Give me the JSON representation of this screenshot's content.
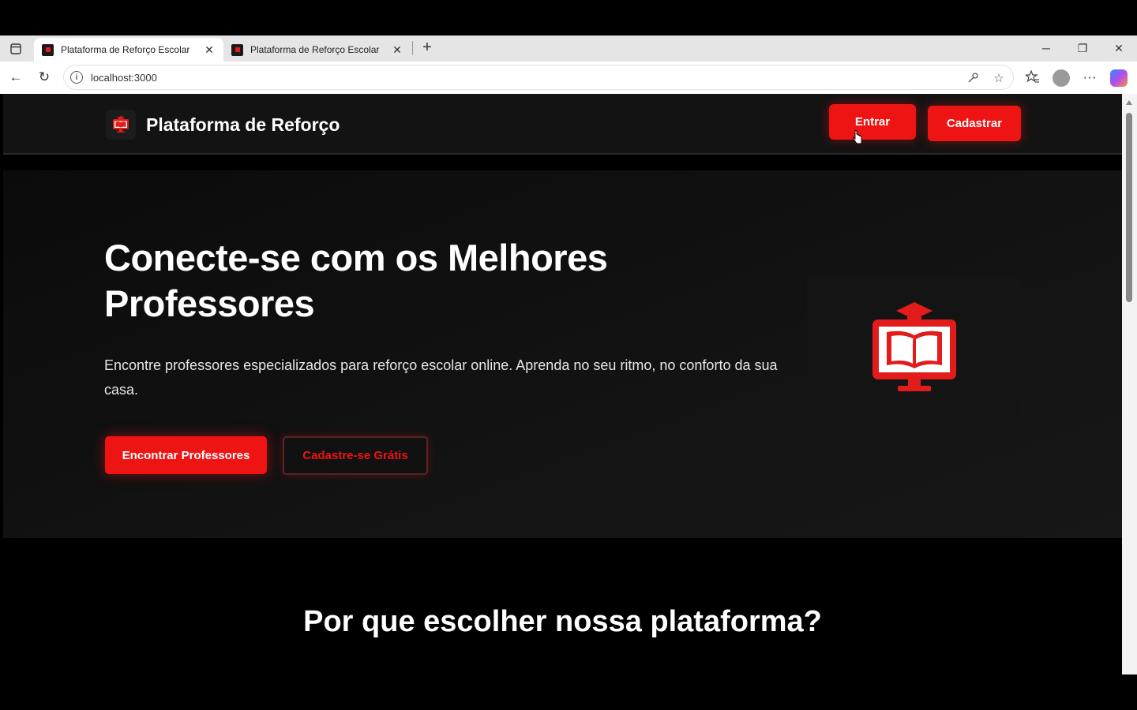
{
  "browser": {
    "tabs": [
      {
        "title": "Plataforma de Reforço Escolar",
        "active": true
      },
      {
        "title": "Plataforma de Reforço Escolar",
        "active": false
      }
    ],
    "url": "localhost:3000",
    "icons": {
      "tab_actions": "tab-actions-icon",
      "new_tab": "+",
      "minimize": "─",
      "restore": "❐",
      "close": "✕",
      "back": "←",
      "reload": "↻",
      "more": "···"
    }
  },
  "header": {
    "brand": "Plataforma de Reforço",
    "login": "Entrar",
    "register": "Cadastrar"
  },
  "hero": {
    "title": "Conecte-se com os Melhores Professores",
    "text": "Encontre professores especializados para reforço escolar online. Aprenda no seu ritmo, no conforto da sua casa.",
    "primary_cta": "Encontrar Professores",
    "secondary_cta": "Cadastre-se Grátis"
  },
  "features": {
    "title": "Por que escolher nossa plataforma?"
  },
  "colors": {
    "accent": "#ee1414",
    "page_bg": "#000000",
    "header_bg": "#131313"
  }
}
